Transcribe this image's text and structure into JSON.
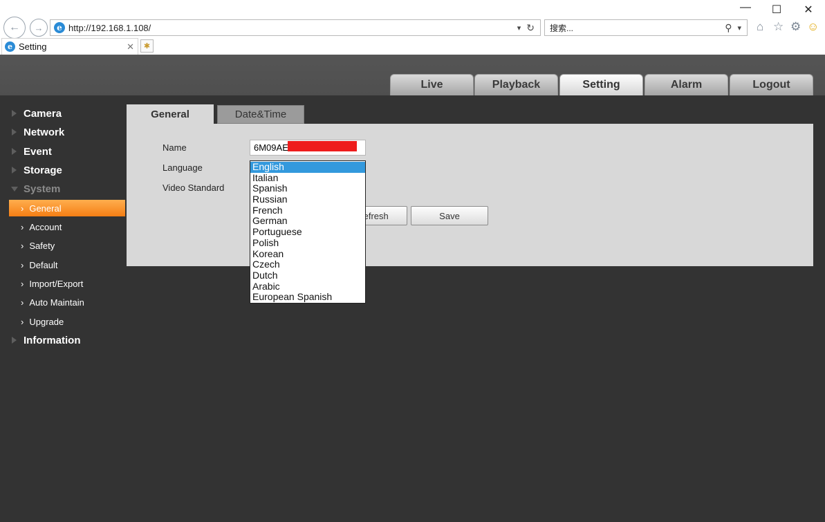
{
  "browser": {
    "url": "http://192.168.1.108/",
    "search_placeholder": "搜索...",
    "tab_title": "Setting"
  },
  "main_tabs": [
    "Live",
    "Playback",
    "Setting",
    "Alarm",
    "Logout"
  ],
  "active_main_tab": "Setting",
  "sidebar": {
    "categories": {
      "camera": "Camera",
      "network": "Network",
      "event": "Event",
      "storage": "Storage",
      "system": "System",
      "information": "Information"
    },
    "system_items": [
      "General",
      "Account",
      "Safety",
      "Default",
      "Import/Export",
      "Auto Maintain",
      "Upgrade"
    ],
    "active_item": "General"
  },
  "sub_tabs": [
    "General",
    "Date&Time"
  ],
  "form": {
    "name_label": "Name",
    "name_value": "6M09AE",
    "language_label": "Language",
    "video_standard_label": "Video Standard",
    "refresh_label": "Refresh",
    "save_label": "Save"
  },
  "language_options": [
    "English",
    "Italian",
    "Spanish",
    "Russian",
    "French",
    "German",
    "Portuguese",
    "Polish",
    "Korean",
    "Czech",
    "Dutch",
    "Arabic",
    "European Spanish"
  ],
  "selected_language": "English",
  "colors": {
    "header_bg": "#555555",
    "body_bg": "#333333",
    "panel_bg": "#d8d8d8",
    "active_sidebar": "#f47e14",
    "dropdown_selected": "#3399dd",
    "redaction": "#ee1c1c"
  }
}
